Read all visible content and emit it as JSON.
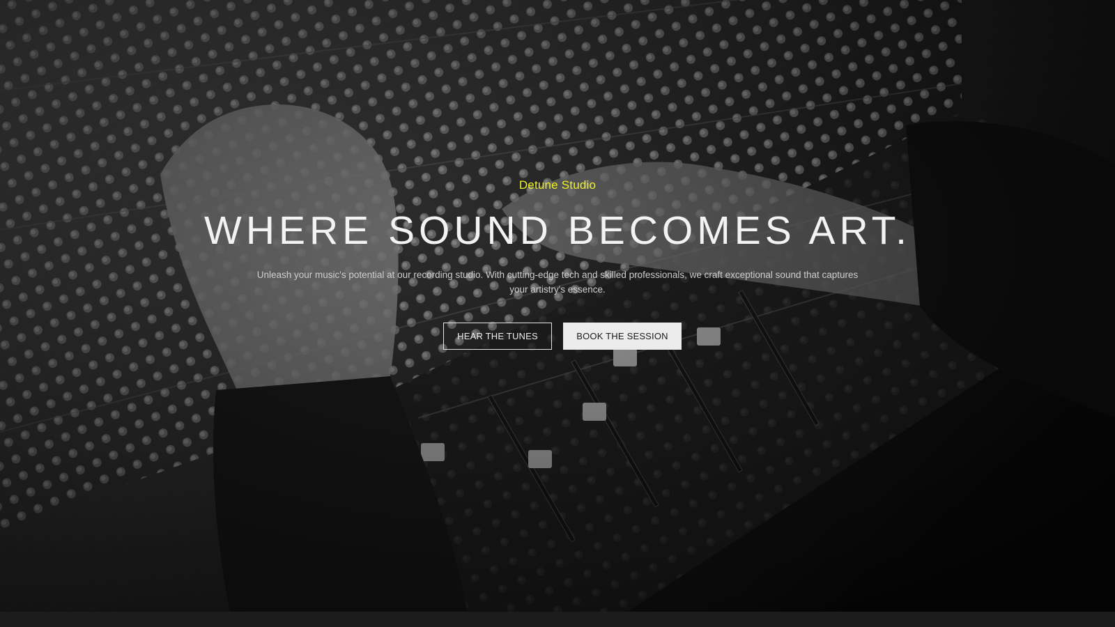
{
  "hero": {
    "brand": "Detune Studio",
    "headline": "WHERE SOUND BECOMES ART.",
    "tagline": "Unleash your music's potential at our recording studio. With cutting-edge tech and skilled professionals, we craft exceptional sound that captures your artistry's essence.",
    "buttons": {
      "primary_label": "HEAR THE TUNES",
      "secondary_label": "BOOK THE SESSION"
    }
  },
  "colors": {
    "brand_accent": "#f2f222",
    "headline_text": "#f3f3f3",
    "secondary_button_bg": "#ececec",
    "footer_bg": "#1c1c1c"
  },
  "background": {
    "image_subject": "mixing-console-photo"
  }
}
